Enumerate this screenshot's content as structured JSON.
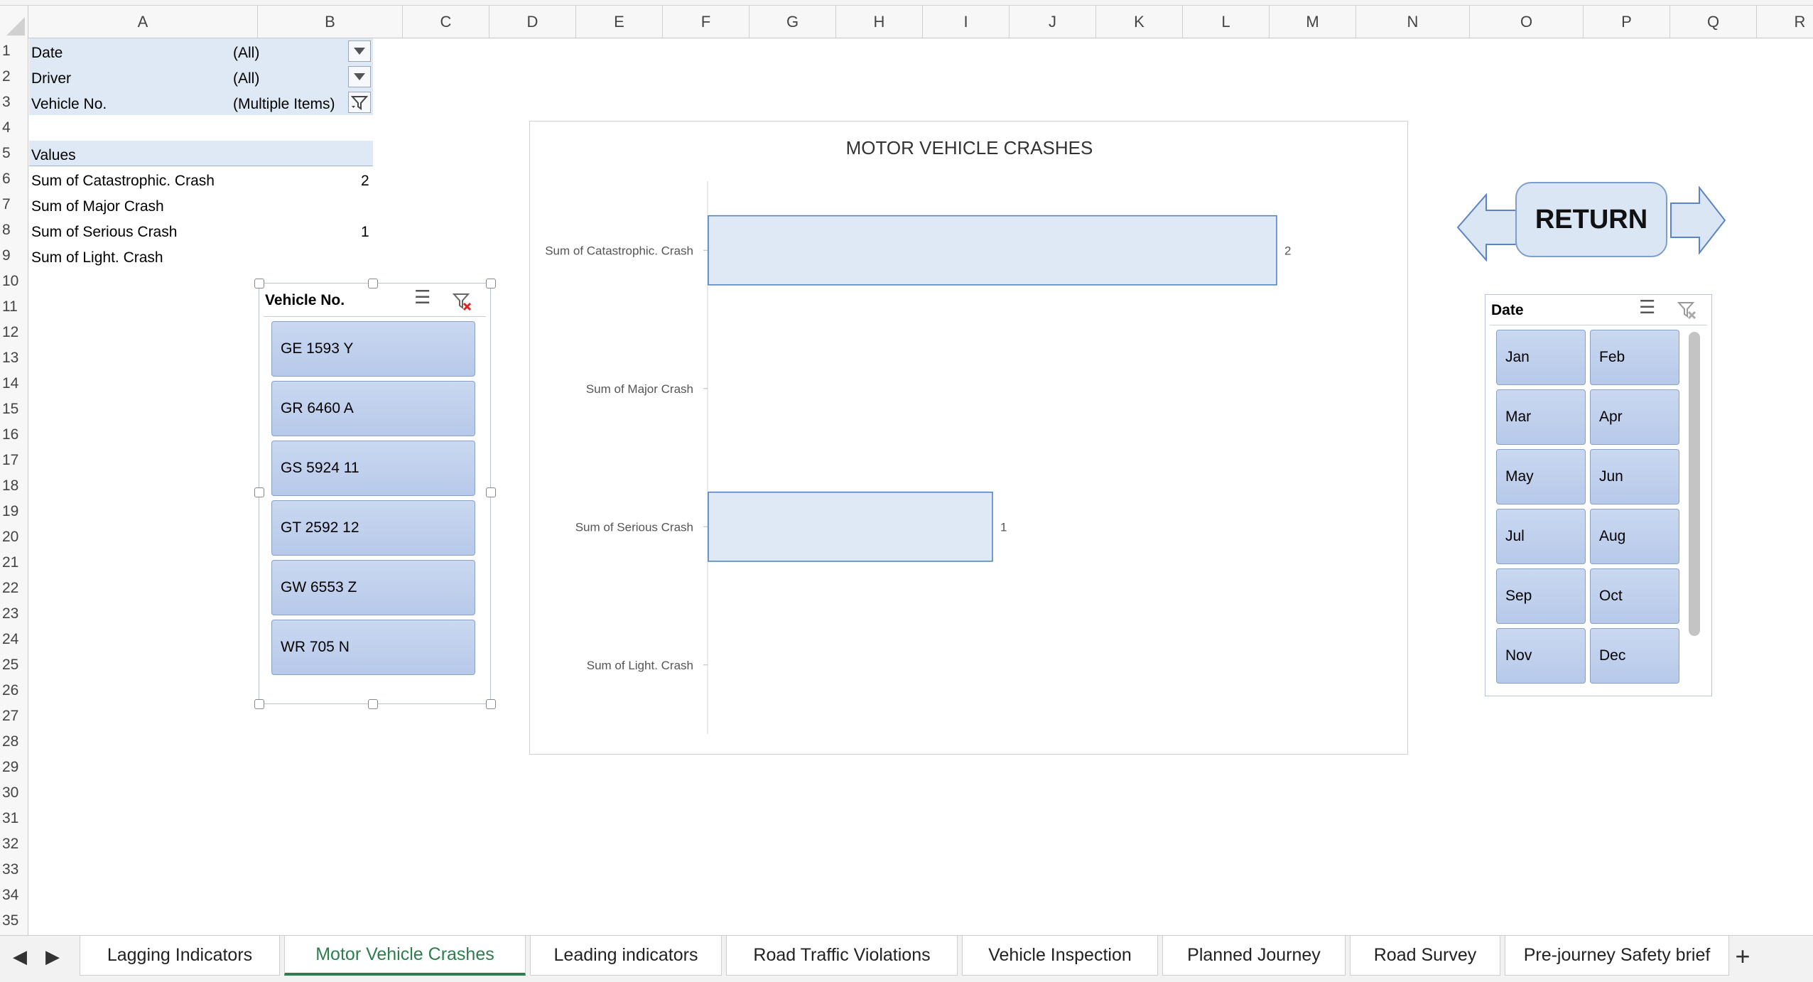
{
  "columns": [
    "A",
    "B",
    "C",
    "D",
    "E",
    "F",
    "G",
    "H",
    "I",
    "J",
    "K",
    "L",
    "M",
    "N",
    "O",
    "P",
    "Q",
    "R"
  ],
  "rows": [
    "1",
    "2",
    "3",
    "4",
    "5",
    "6",
    "7",
    "8",
    "9",
    "10",
    "11",
    "12",
    "13",
    "14",
    "15",
    "16",
    "17",
    "18",
    "19",
    "20",
    "21",
    "22",
    "23",
    "24",
    "25",
    "26",
    "27",
    "28",
    "29",
    "30",
    "31",
    "32",
    "33",
    "34",
    "35"
  ],
  "pivot": {
    "filters": [
      {
        "label": "Date",
        "value": "(All)"
      },
      {
        "label": "Driver",
        "value": "(All)"
      },
      {
        "label": "Vehicle No.",
        "value": "(Multiple Items)"
      }
    ],
    "values_header": "Values",
    "rows": [
      {
        "label": "Sum of Catastrophic. Crash",
        "value": "2"
      },
      {
        "label": "Sum of Major Crash",
        "value": ""
      },
      {
        "label": "Sum of Serious Crash",
        "value": "1"
      },
      {
        "label": "Sum of Light. Crash",
        "value": ""
      }
    ]
  },
  "vehicle_slicer": {
    "title": "Vehicle No.",
    "items": [
      "GE 1593 Y",
      "GR 6460 A",
      "GS 5924 11",
      "GT 2592 12",
      "GW 6553 Z",
      "WR 705 N"
    ]
  },
  "date_slicer": {
    "title": "Date",
    "items": [
      "Jan",
      "Feb",
      "Mar",
      "Apr",
      "May",
      "Jun",
      "Jul",
      "Aug",
      "Sep",
      "Oct",
      "Nov",
      "Dec"
    ]
  },
  "return_button": {
    "label": "RETURN"
  },
  "chart_data": {
    "type": "bar",
    "orientation": "horizontal",
    "title": "MOTOR VEHICLE CRASHES",
    "categories": [
      "Sum of Catastrophic. Crash",
      "Sum of Major Crash",
      "Sum of Serious Crash",
      "Sum of Light. Crash"
    ],
    "values": [
      2,
      0,
      1,
      0
    ],
    "data_labels": [
      "2",
      "",
      "1",
      ""
    ],
    "xlim": [
      0,
      2.3
    ],
    "bar_color": "#dfe9f5",
    "bar_border": "#4a7ebb"
  },
  "tabs": [
    {
      "label": "Lagging Indicators",
      "active": false
    },
    {
      "label": "Motor Vehicle Crashes",
      "active": true
    },
    {
      "label": "Leading indicators",
      "active": false
    },
    {
      "label": "Road Traffic Violations",
      "active": false
    },
    {
      "label": "Vehicle Inspection",
      "active": false
    },
    {
      "label": "Planned Journey",
      "active": false
    },
    {
      "label": "Road Survey",
      "active": false
    },
    {
      "label": "Pre-journey Safety brief",
      "active": false
    }
  ],
  "tab_controls": {
    "prev": "◀",
    "next": "▶",
    "add": "+"
  },
  "colors": {
    "accent": "#2e7d4f",
    "pivot_fill": "#dfe9f5",
    "slicer_item": "#b7c9ea"
  }
}
